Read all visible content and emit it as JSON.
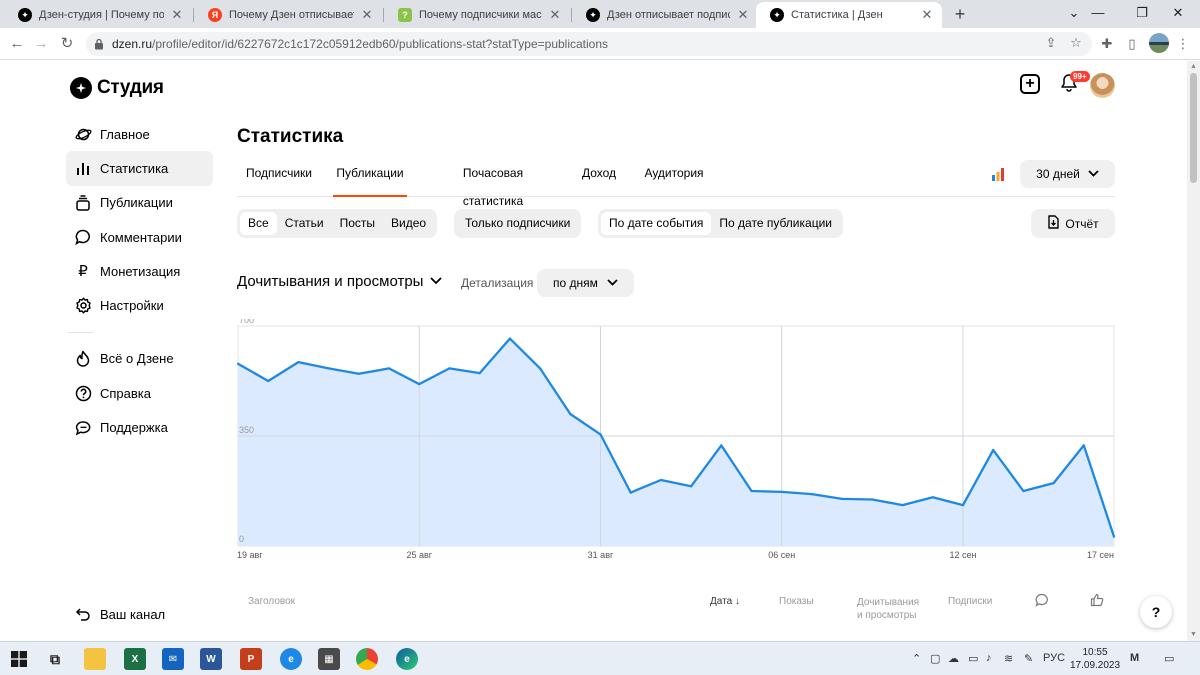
{
  "browser": {
    "tabs": [
      {
        "title": "Дзен-студия | Почему подписчик",
        "icon": "dzen-icon",
        "color": "#000000",
        "active": false
      },
      {
        "title": "Почему Дзен отписывает подп",
        "icon": "yandex-icon",
        "color": "#fc3f1d",
        "active": false
      },
      {
        "title": "Почему подписчики массово о",
        "icon": "answers-icon",
        "color": "#8bc34a",
        "active": false
      },
      {
        "title": "Дзен отписывает подписчиков",
        "icon": "dzen-icon",
        "color": "#000000",
        "active": false
      },
      {
        "title": "Статистика | Дзен",
        "icon": "dzen-icon",
        "color": "#000000",
        "active": true
      }
    ],
    "url_host": "dzen.ru",
    "url_path": "/profile/editor/id/6227672c1c172c05912edb60/publications-stat?statType=publications"
  },
  "logo": {
    "text": "Студия"
  },
  "sidebar": {
    "items": [
      {
        "label": "Главное",
        "icon": "planet-icon"
      },
      {
        "label": "Статистика",
        "icon": "bar-chart-icon",
        "active": true
      },
      {
        "label": "Публикации",
        "icon": "stack-icon"
      },
      {
        "label": "Комментарии",
        "icon": "comment-icon"
      },
      {
        "label": "Монетизация",
        "icon": "ruble-icon"
      },
      {
        "label": "Настройки",
        "icon": "gear-icon"
      }
    ],
    "items2": [
      {
        "label": "Всё о Дзене",
        "icon": "flame-icon"
      },
      {
        "label": "Справка",
        "icon": "question-icon"
      },
      {
        "label": "Поддержка",
        "icon": "chat-icon"
      }
    ],
    "bottom": {
      "label": "Ваш канал",
      "icon": "back-arrow-icon"
    }
  },
  "header": {
    "badge": "99+"
  },
  "page": {
    "title": "Статистика"
  },
  "tabs": [
    {
      "label": "Подписчики"
    },
    {
      "label": "Публикации",
      "active": true
    },
    {
      "label": "Почасовая статистика"
    },
    {
      "label": "Доход"
    },
    {
      "label": "Аудитория"
    }
  ],
  "period": {
    "label": "30 дней"
  },
  "filters": {
    "types": [
      "Все",
      "Статьи",
      "Посты",
      "Видео"
    ],
    "subscribers_only": "Только подписчики",
    "date_modes": [
      "По дате события",
      "По дате публикации"
    ],
    "report": "Отчёт"
  },
  "metric": {
    "title": "Дочитывания и просмотры",
    "detail_label": "Детализация",
    "detail_value": "по дням"
  },
  "chart_data": {
    "type": "area",
    "x": [
      "19 авг",
      "20 авг",
      "21 авг",
      "22 авг",
      "23 авг",
      "24 авг",
      "25 авг",
      "26 авг",
      "27 авг",
      "28 авг",
      "29 авг",
      "30 авг",
      "31 авг",
      "01 сен",
      "02 сен",
      "03 сен",
      "04 сен",
      "05 сен",
      "06 сен",
      "07 сен",
      "08 сен",
      "09 сен",
      "10 сен",
      "11 сен",
      "12 сен",
      "13 сен",
      "14 сен",
      "15 сен",
      "16 сен",
      "17 сен"
    ],
    "values": [
      580,
      525,
      585,
      565,
      548,
      565,
      515,
      565,
      550,
      660,
      565,
      420,
      355,
      170,
      210,
      190,
      320,
      175,
      172,
      165,
      150,
      148,
      130,
      155,
      130,
      305,
      175,
      200,
      320,
      30
    ],
    "ylim": [
      0,
      700
    ],
    "yticks": [
      "0",
      "350",
      "700"
    ],
    "xticks": [
      "19 авг",
      "25 авг",
      "31 авг",
      "06 сен",
      "12 сен",
      "17 сен"
    ],
    "grid": true,
    "line_color": "#1e88e5",
    "fill_color": "#dbeafe"
  },
  "table": {
    "headers": [
      "Заголовок",
      "Дата",
      "Показы",
      "Дочитывания",
      "и просмотры",
      "Подписки"
    ],
    "sort_arrow": "↓"
  },
  "help": {
    "label": "?"
  },
  "taskbar": {
    "lang": "РУС",
    "time": "10:55",
    "date": "17.09.2023"
  }
}
